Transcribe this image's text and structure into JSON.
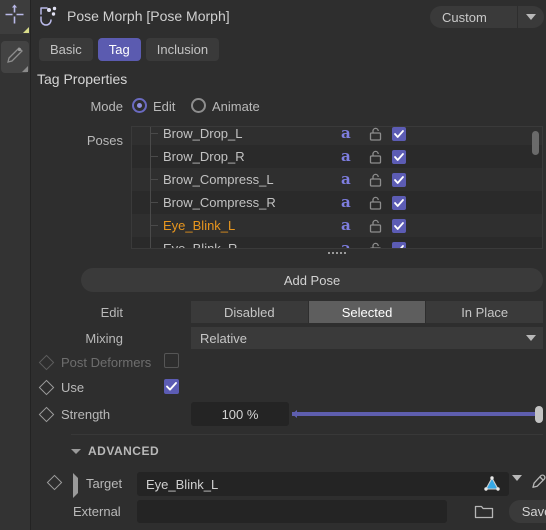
{
  "toolstrip": {
    "buttons": [
      {
        "name": "move-tool",
        "icon": "move-tool-icon"
      },
      {
        "name": "polygon-pen-tool",
        "icon": "polygon-pen-icon"
      }
    ]
  },
  "header": {
    "icon": "pose-morph-tag-icon",
    "title": "Pose Morph [Pose Morph]",
    "layout_select": {
      "value": "Custom",
      "icon": "chevron-down-icon"
    }
  },
  "tabs": [
    {
      "label": "Basic",
      "active": false
    },
    {
      "label": "Tag",
      "active": true
    },
    {
      "label": "Inclusion",
      "active": false
    }
  ],
  "section": {
    "title": "Tag Properties"
  },
  "mode": {
    "label": "Mode",
    "options": [
      {
        "label": "Edit",
        "selected": true
      },
      {
        "label": "Animate",
        "selected": false
      }
    ]
  },
  "poses": {
    "label": "Poses",
    "columns": [
      "name",
      "animate",
      "lock",
      "enabled"
    ],
    "rows": [
      {
        "name": "Brow_Drop_L",
        "animate": "a",
        "locked": false,
        "enabled": true,
        "selected": false
      },
      {
        "name": "Brow_Drop_R",
        "animate": "a",
        "locked": false,
        "enabled": true,
        "selected": false
      },
      {
        "name": "Brow_Compress_L",
        "animate": "a",
        "locked": false,
        "enabled": true,
        "selected": false
      },
      {
        "name": "Brow_Compress_R",
        "animate": "a",
        "locked": false,
        "enabled": true,
        "selected": false
      },
      {
        "name": "Eye_Blink_L",
        "animate": "a",
        "locked": false,
        "enabled": true,
        "selected": true
      },
      {
        "name": "Eye_Blink_R",
        "animate": "a",
        "locked": false,
        "enabled": true,
        "selected": false
      }
    ],
    "selected_color": "#e8961e"
  },
  "add_pose": {
    "label": "Add Pose"
  },
  "edit": {
    "label": "Edit",
    "options": [
      {
        "label": "Disabled",
        "active": false
      },
      {
        "label": "Selected",
        "active": true
      },
      {
        "label": "In Place",
        "active": false
      }
    ]
  },
  "mixing": {
    "label": "Mixing",
    "value": "Relative"
  },
  "post_deformers": {
    "label": "Post Deformers",
    "checked": false,
    "disabled": true
  },
  "use": {
    "label": "Use",
    "checked": true
  },
  "strength": {
    "label": "Strength",
    "value": "100 %",
    "percent": 100
  },
  "advanced": {
    "label": "ADVANCED",
    "expanded": true
  },
  "target": {
    "label": "Target",
    "value": "Eye_Blink_L",
    "object_icon": "object-link-icon",
    "picker_icon": "eyedropper-icon",
    "dropdown_icon": "chevron-down-icon"
  },
  "external": {
    "label": "External",
    "value": "",
    "browse_icon": "folder-icon",
    "save_label": "Save..."
  },
  "colors": {
    "accent": "#5c5cb4",
    "panel_bg": "#2e2e2e",
    "field_bg": "#242424",
    "button_bg": "#3a3a3a",
    "highlight": "#e8961e"
  }
}
